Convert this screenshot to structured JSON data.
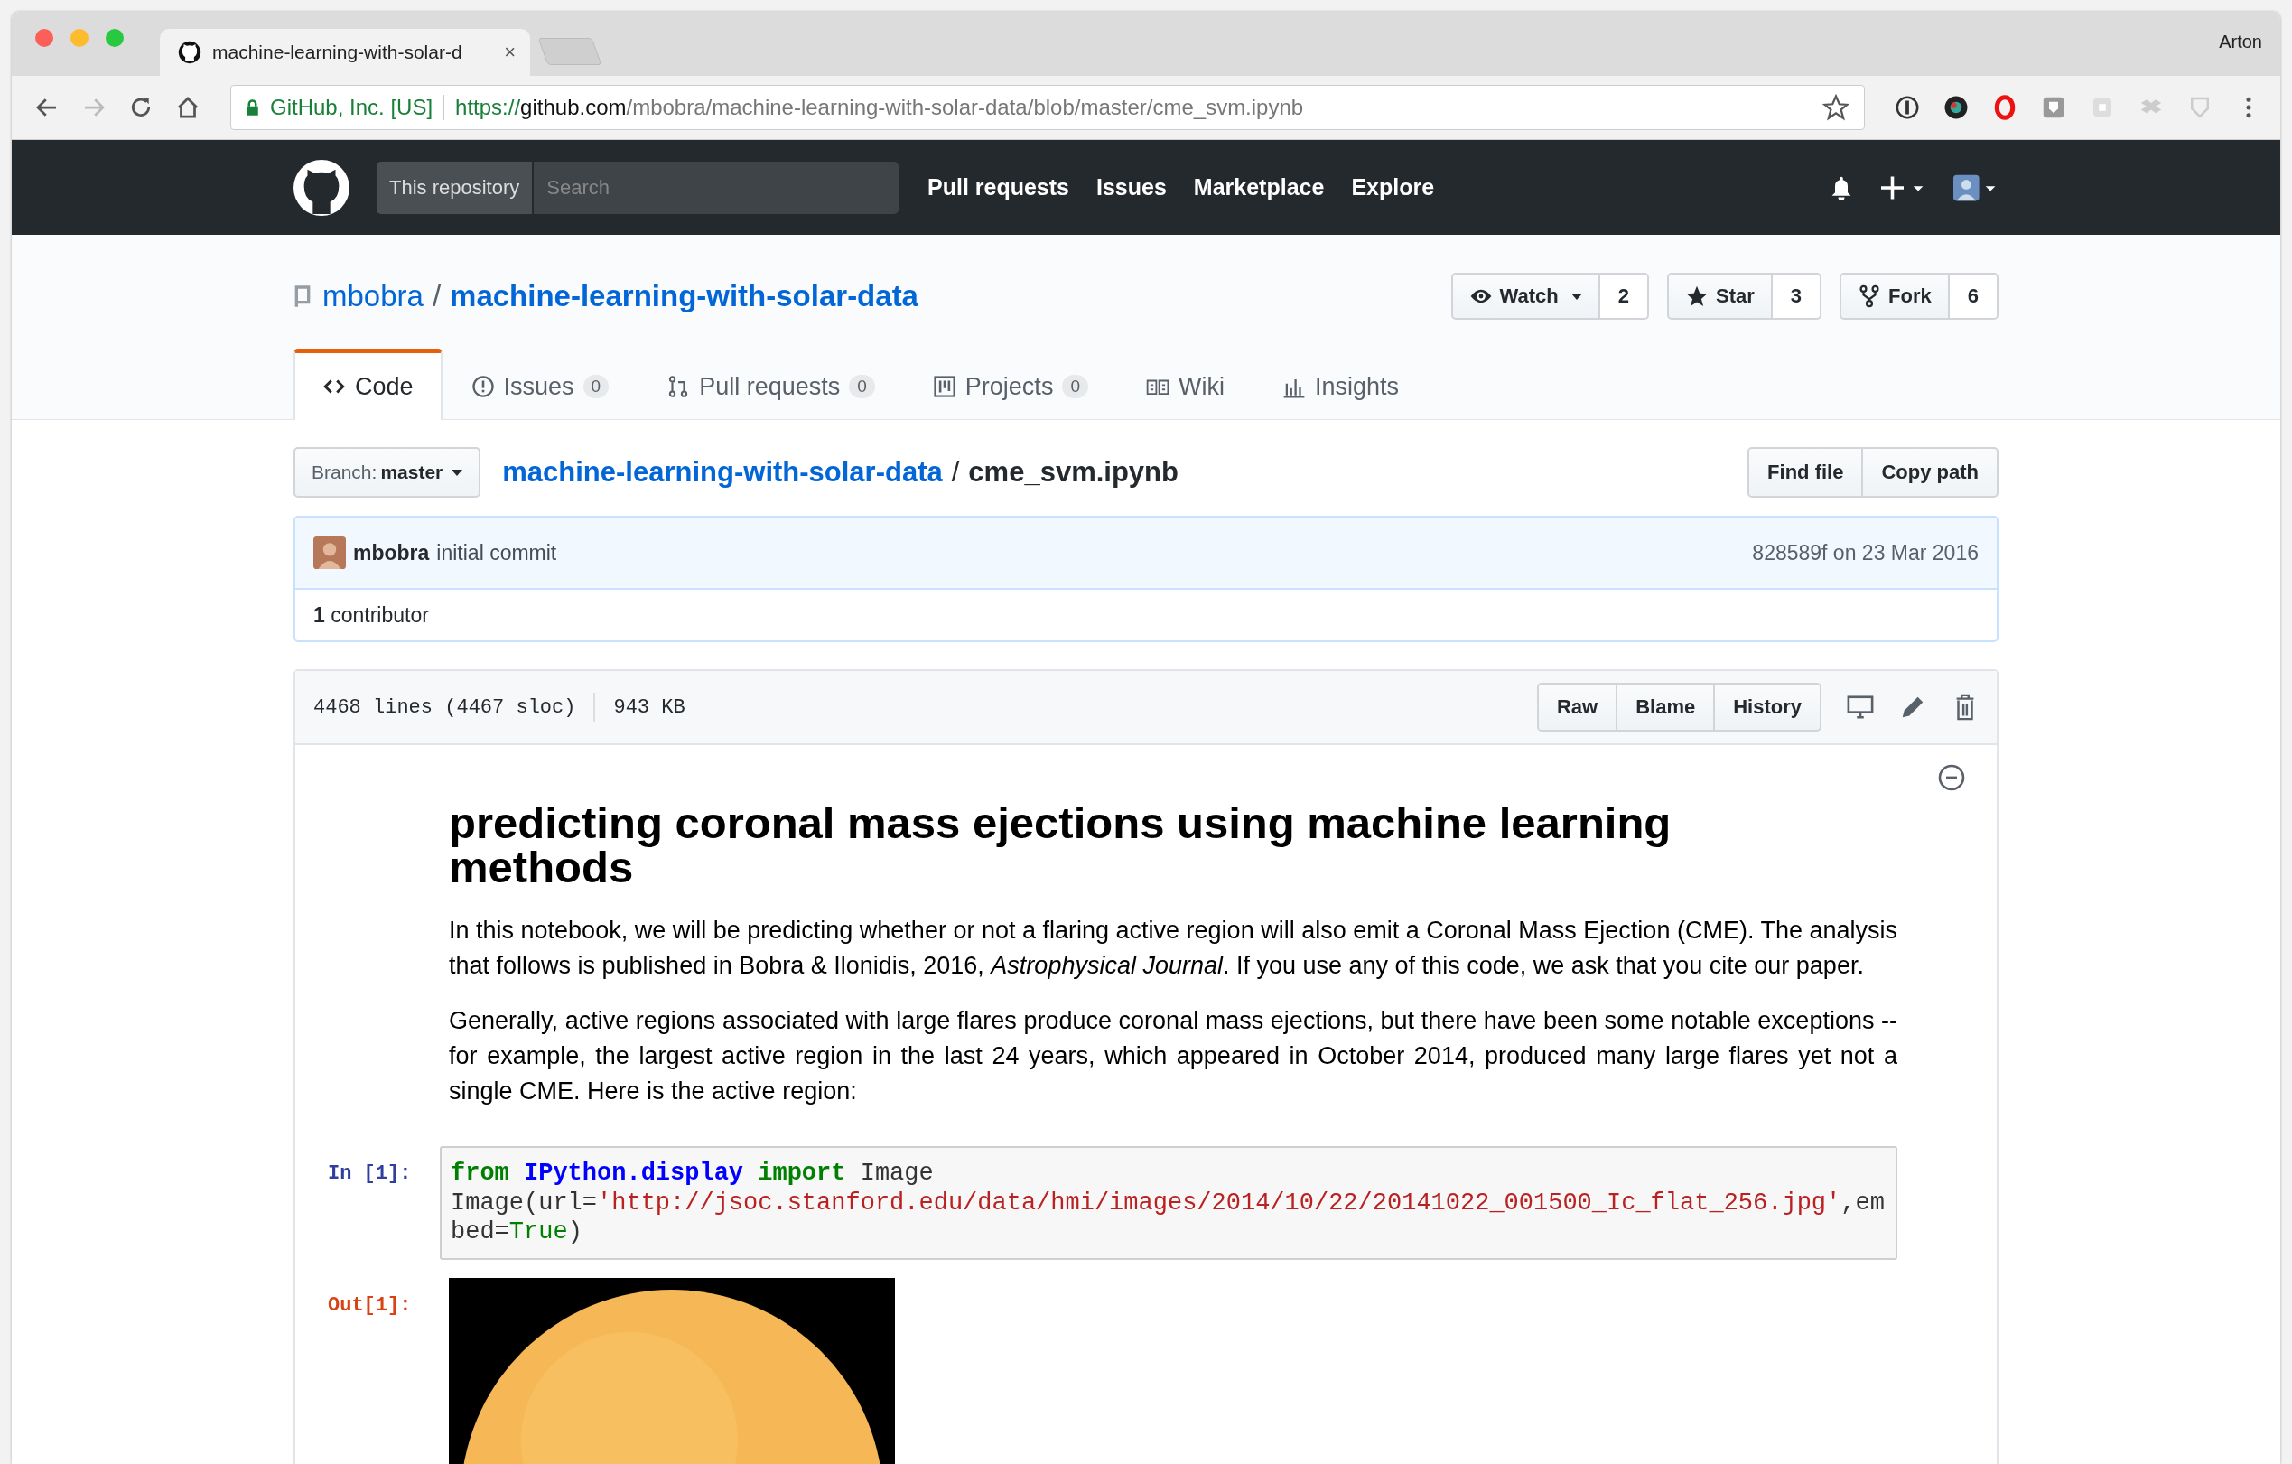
{
  "browser": {
    "tab_title": "machine-learning-with-solar-d",
    "tab_close": "×",
    "profile": "Arton",
    "security": "GitHub, Inc. [US]",
    "url_scheme": "https://",
    "url_host": "github.com",
    "url_path": "/mbobra/machine-learning-with-solar-data/blob/master/cme_svm.ipynb"
  },
  "header": {
    "scope": "This repository",
    "search_placeholder": "Search",
    "nav": [
      "Pull requests",
      "Issues",
      "Marketplace",
      "Explore"
    ]
  },
  "repo": {
    "owner": "mbobra",
    "separator": "/",
    "name": "machine-learning-with-solar-data",
    "actions": [
      {
        "kind": "watch",
        "label": "Watch",
        "count": "2"
      },
      {
        "kind": "star",
        "label": "Star",
        "count": "3"
      },
      {
        "kind": "fork",
        "label": "Fork",
        "count": "6"
      }
    ]
  },
  "tabs": [
    {
      "kind": "code",
      "label": "Code",
      "selected": true
    },
    {
      "kind": "issues",
      "label": "Issues",
      "count": "0",
      "selected": false
    },
    {
      "kind": "pulls",
      "label": "Pull requests",
      "count": "0",
      "selected": false
    },
    {
      "kind": "projects",
      "label": "Projects",
      "count": "0",
      "selected": false
    },
    {
      "kind": "wiki",
      "label": "Wiki",
      "selected": false
    },
    {
      "kind": "insights",
      "label": "Insights",
      "selected": false
    }
  ],
  "file_nav": {
    "branch_label": "Branch:",
    "branch": "master",
    "repo_link": "machine-learning-with-solar-data",
    "separator": "/",
    "file": "cme_svm.ipynb",
    "buttons": [
      "Find file",
      "Copy path"
    ]
  },
  "commit": {
    "author": "mbobra",
    "message": "initial commit",
    "sha_date": "828589f on 23 Mar 2016",
    "contributors": "**1** contributor"
  },
  "file_header": {
    "lines": "4468 lines (4467 sloc)",
    "size": "943 KB",
    "buttons": [
      "Raw",
      "Blame",
      "History"
    ]
  },
  "notebook": {
    "heading": "predicting coronal mass ejections using machine learning methods",
    "paragraphs": [
      "In this notebook, we will be predicting whether or not a flaring active region will also emit a Coronal Mass Ejection (CME). The analysis that follows is published in Bobra & Ilonidis, 2016, *Astrophysical Journal*. If you use any of this code, we ask that you cite our paper.",
      "Generally, active regions associated with large flares produce coronal mass ejections, but there have been some notable exceptions -- for example, the largest active region in the last 24 years, which appeared in October 2014, produced many large flares yet not a single CME. Here is the active region:"
    ],
    "cells": [
      {
        "kind": "input",
        "prompt": "In [1]:",
        "lines": [
          [
            {
              "kind": "keyword",
              "text": "from"
            },
            {
              "kind": "module",
              "text": " IPython.display"
            },
            {
              "kind": "keyword",
              "text": " import"
            },
            {
              "kind": "plain",
              "text": " Image"
            }
          ],
          [
            {
              "kind": "plain",
              "text": "Image(url="
            },
            {
              "kind": "string",
              "text": "'http://jsoc.stanford.edu/data/hmi/images/2014/10/22/20141022_001500_Ic_flat_256.jpg'"
            },
            {
              "kind": "plain",
              "text": ",em"
            }
          ],
          [
            {
              "kind": "plain",
              "text": "bed="
            },
            {
              "kind": "builtin",
              "text": "True"
            },
            {
              "kind": "plain",
              "text": ")"
            }
          ]
        ]
      },
      {
        "kind": "output",
        "prompt": "Out[1]:"
      }
    ]
  }
}
